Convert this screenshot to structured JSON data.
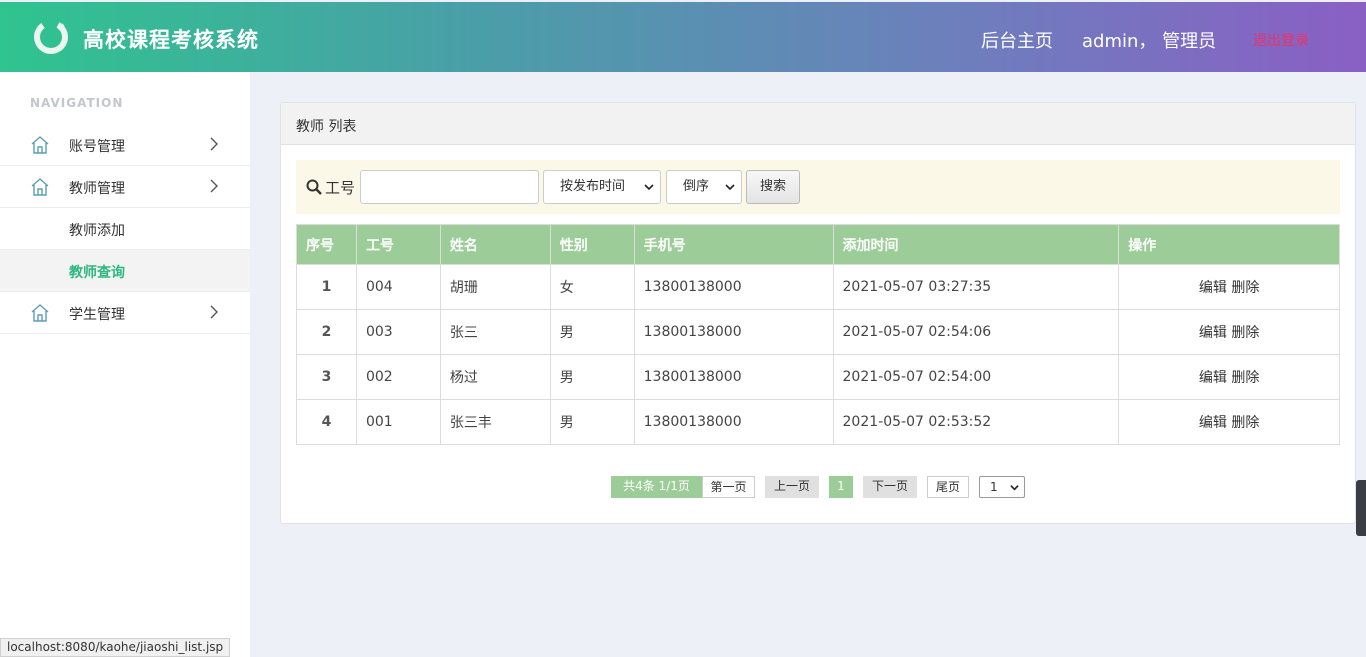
{
  "header": {
    "app_title": "高校课程考核系统",
    "home_link": "后台主页",
    "user_label": "admin， 管理员",
    "logout_link": "退出登录"
  },
  "sidebar": {
    "nav_title": "NAVIGATION",
    "items": [
      {
        "label": "账号管理",
        "icon": "home-icon",
        "expandable": true
      },
      {
        "label": "教师管理",
        "icon": "home-icon",
        "expandable": true
      },
      {
        "label": "教师添加",
        "sub": true
      },
      {
        "label": "教师查询",
        "sub": true,
        "active": true
      },
      {
        "label": "学生管理",
        "icon": "home-icon",
        "expandable": true
      }
    ]
  },
  "panel": {
    "title": "教师 列表",
    "search": {
      "label": "工号",
      "input_value": "",
      "sort_field": "按发布时间",
      "sort_order": "倒序",
      "button": "搜索"
    },
    "table": {
      "columns": [
        "序号",
        "工号",
        "姓名",
        "性别",
        "手机号",
        "添加时间",
        "操作"
      ],
      "rows": [
        {
          "idx": "1",
          "id": "004",
          "name": "胡珊",
          "gender": "女",
          "phone": "13800138000",
          "time": "2021-05-07 03:27:35"
        },
        {
          "idx": "2",
          "id": "003",
          "name": "张三",
          "gender": "男",
          "phone": "13800138000",
          "time": "2021-05-07 02:54:06"
        },
        {
          "idx": "3",
          "id": "002",
          "name": "杨过",
          "gender": "男",
          "phone": "13800138000",
          "time": "2021-05-07 02:54:00"
        },
        {
          "idx": "4",
          "id": "001",
          "name": "张三丰",
          "gender": "男",
          "phone": "13800138000",
          "time": "2021-05-07 02:53:52"
        }
      ],
      "op_edit": "编辑",
      "op_delete": "删除"
    },
    "pager": {
      "info": "共4条   1/1页",
      "first": "第一页",
      "prev": "上一页",
      "current": "1",
      "next": "下一页",
      "last": "尾页",
      "page_select": "1"
    }
  },
  "status_bar": "localhost:8080/kaohe/jiaoshi_list.jsp",
  "colors": {
    "header_gradient_start": "#2fc48f",
    "header_gradient_end": "#8a5fc4",
    "accent_green": "#9ccd98",
    "active_menu": "#2fb87d",
    "logout": "#e8336b"
  }
}
